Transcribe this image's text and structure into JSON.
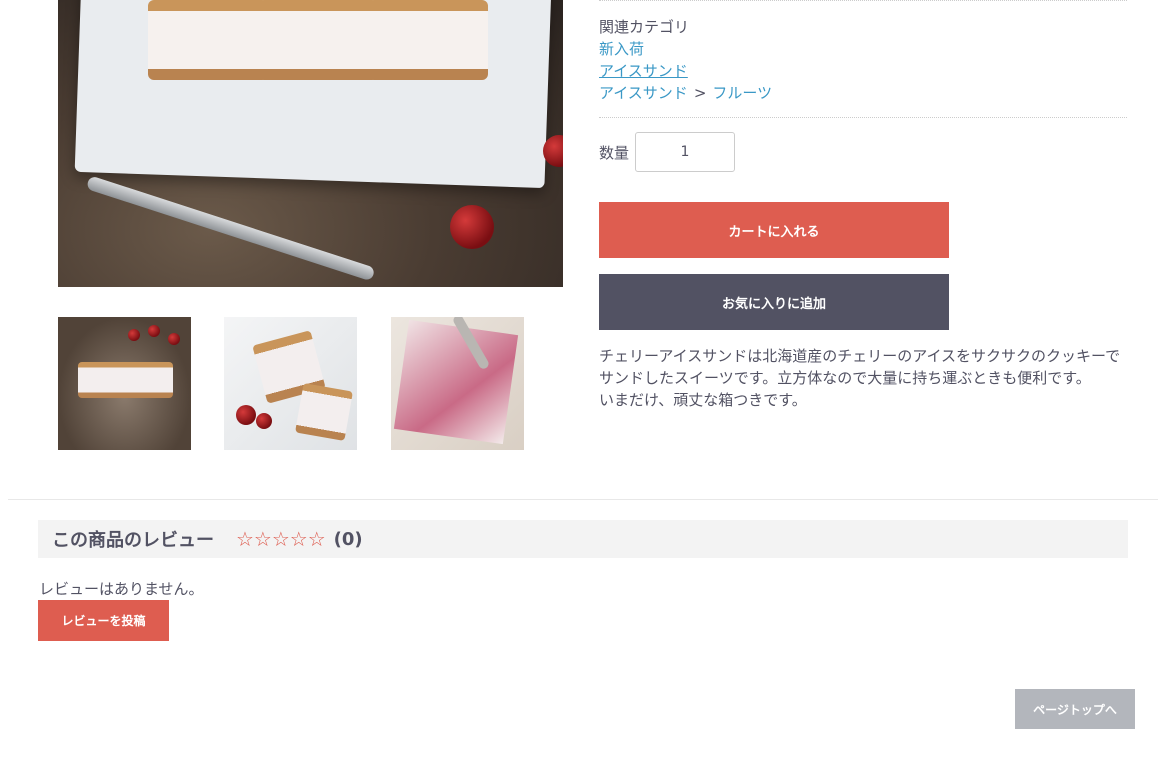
{
  "related": {
    "title": "関連カテゴリ",
    "links": [
      "新入荷",
      "アイスサンド"
    ],
    "path": [
      "アイスサンド",
      "フルーツ"
    ],
    "path_separator": ">"
  },
  "quantity": {
    "label": "数量",
    "value": "1"
  },
  "buttons": {
    "add_to_cart": "カートに入れる",
    "add_to_favorites": "お気に入りに追加"
  },
  "description": {
    "line1": "チェリーアイスサンドは北海道産のチェリーのアイスをサクサクのクッキーでサンドしたスイーツです。立方体なので大量に持ち運ぶときも便利です。",
    "line2": "いまだけ、頑丈な箱つきです。"
  },
  "reviews": {
    "title": "この商品のレビュー",
    "stars": "☆☆☆☆☆",
    "count": "(0)",
    "empty_text": "レビューはありません。",
    "post_button": "レビューを投稿"
  },
  "page_top": "ページトップへ",
  "colors": {
    "accent": "#de5d50",
    "dark_button": "#525263",
    "link": "#3a98c6",
    "page_top_button": "#b3b6bc"
  }
}
